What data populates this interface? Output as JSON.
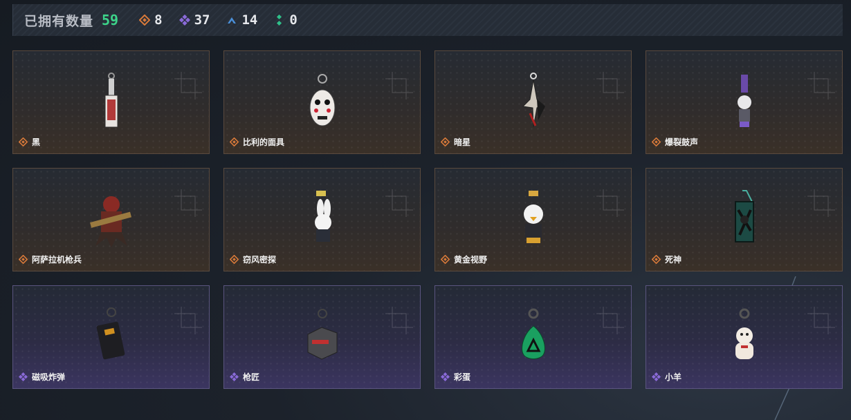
{
  "header": {
    "title": "已拥有数量",
    "total": "59",
    "stats": [
      {
        "icon": "orange-diamond-icon",
        "color": "#d97a3a",
        "value": "8"
      },
      {
        "icon": "purple-diamond-icon",
        "color": "#8a6ad8",
        "value": "37"
      },
      {
        "icon": "blue-chevron-icon",
        "color": "#4a8fd8",
        "value": "14"
      },
      {
        "icon": "green-dots-icon",
        "color": "#2fc08a",
        "value": "0"
      }
    ]
  },
  "items": [
    {
      "name": "黑",
      "rarity": "orange",
      "icon": "keychain-tag-icon"
    },
    {
      "name": "比利的面具",
      "rarity": "orange",
      "icon": "keychain-mask-icon"
    },
    {
      "name": "暗星",
      "rarity": "orange",
      "icon": "keychain-star-icon"
    },
    {
      "name": "爆裂鼓声",
      "rarity": "orange",
      "icon": "keychain-figure-icon"
    },
    {
      "name": "阿萨拉机枪兵",
      "rarity": "orange",
      "icon": "keychain-gunner-icon"
    },
    {
      "name": "窃风密探",
      "rarity": "orange",
      "icon": "keychain-rabbit-icon"
    },
    {
      "name": "黄金视野",
      "rarity": "orange",
      "icon": "keychain-chick-icon"
    },
    {
      "name": "死神",
      "rarity": "orange",
      "icon": "keychain-card-icon"
    },
    {
      "name": "磁吸炸弹",
      "rarity": "purple",
      "icon": "keychain-bomb-icon"
    },
    {
      "name": "枪匠",
      "rarity": "purple",
      "icon": "keychain-crate-icon"
    },
    {
      "name": "彩蛋",
      "rarity": "purple",
      "icon": "keychain-egg-icon"
    },
    {
      "name": "小羊",
      "rarity": "purple",
      "icon": "keychain-lucky-cat-icon"
    }
  ],
  "colors": {
    "orange": "#d97a3a",
    "purple": "#8a6ad8",
    "total": "#3dd48a"
  }
}
